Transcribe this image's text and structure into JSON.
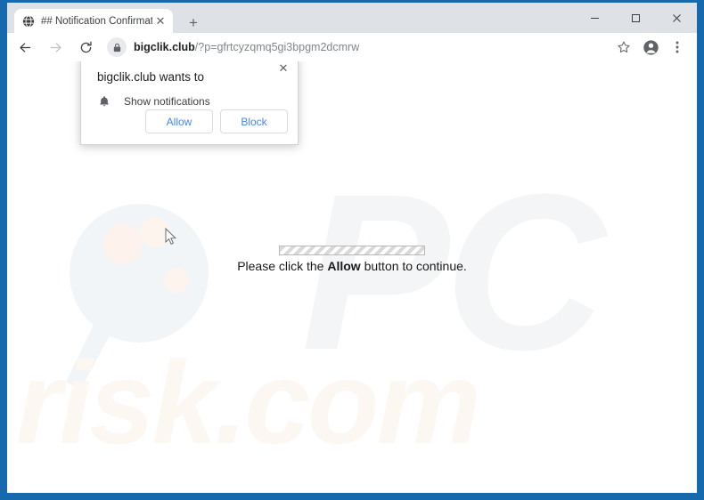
{
  "window": {
    "frame_color": "#1769ad",
    "controls": [
      {
        "name": "minimize",
        "glyph": "–"
      },
      {
        "name": "maximize",
        "glyph": "□"
      },
      {
        "name": "close",
        "glyph": "✕"
      }
    ]
  },
  "tabs": {
    "active": {
      "title": "## Notification Confirmation ##",
      "favicon": "globe-icon",
      "close_glyph": "✕"
    },
    "new_tab_glyph": "+"
  },
  "toolbar": {
    "back_icon": "back-arrow-icon",
    "forward_icon": "forward-arrow-icon",
    "reload_icon": "reload-icon",
    "lock_icon": "lock-icon",
    "url_domain": "bigclik.club",
    "url_path": "/?p=gfrtcyzqmq5gi3bpgm2dcmrw",
    "bookmark_icon": "star-icon",
    "profile_icon": "profile-avatar-icon",
    "menu_icon": "three-dot-menu-icon"
  },
  "permission_bubble": {
    "title": "bigclik.club wants to",
    "option_icon": "bell-icon",
    "option_label": "Show notifications",
    "allow_label": "Allow",
    "block_label": "Block",
    "close_glyph": "✕",
    "accent_color": "#4285f4"
  },
  "page": {
    "message_prefix": "Please click the ",
    "message_emphasis": "Allow",
    "message_suffix": " button to continue.",
    "progress_bar": "striped-progress-bar",
    "watermark_pc": "PC",
    "watermark_risk": "risk.com",
    "watermark_magnifier": "magnifying-glass-watermark",
    "cursor": "arrow-cursor"
  }
}
